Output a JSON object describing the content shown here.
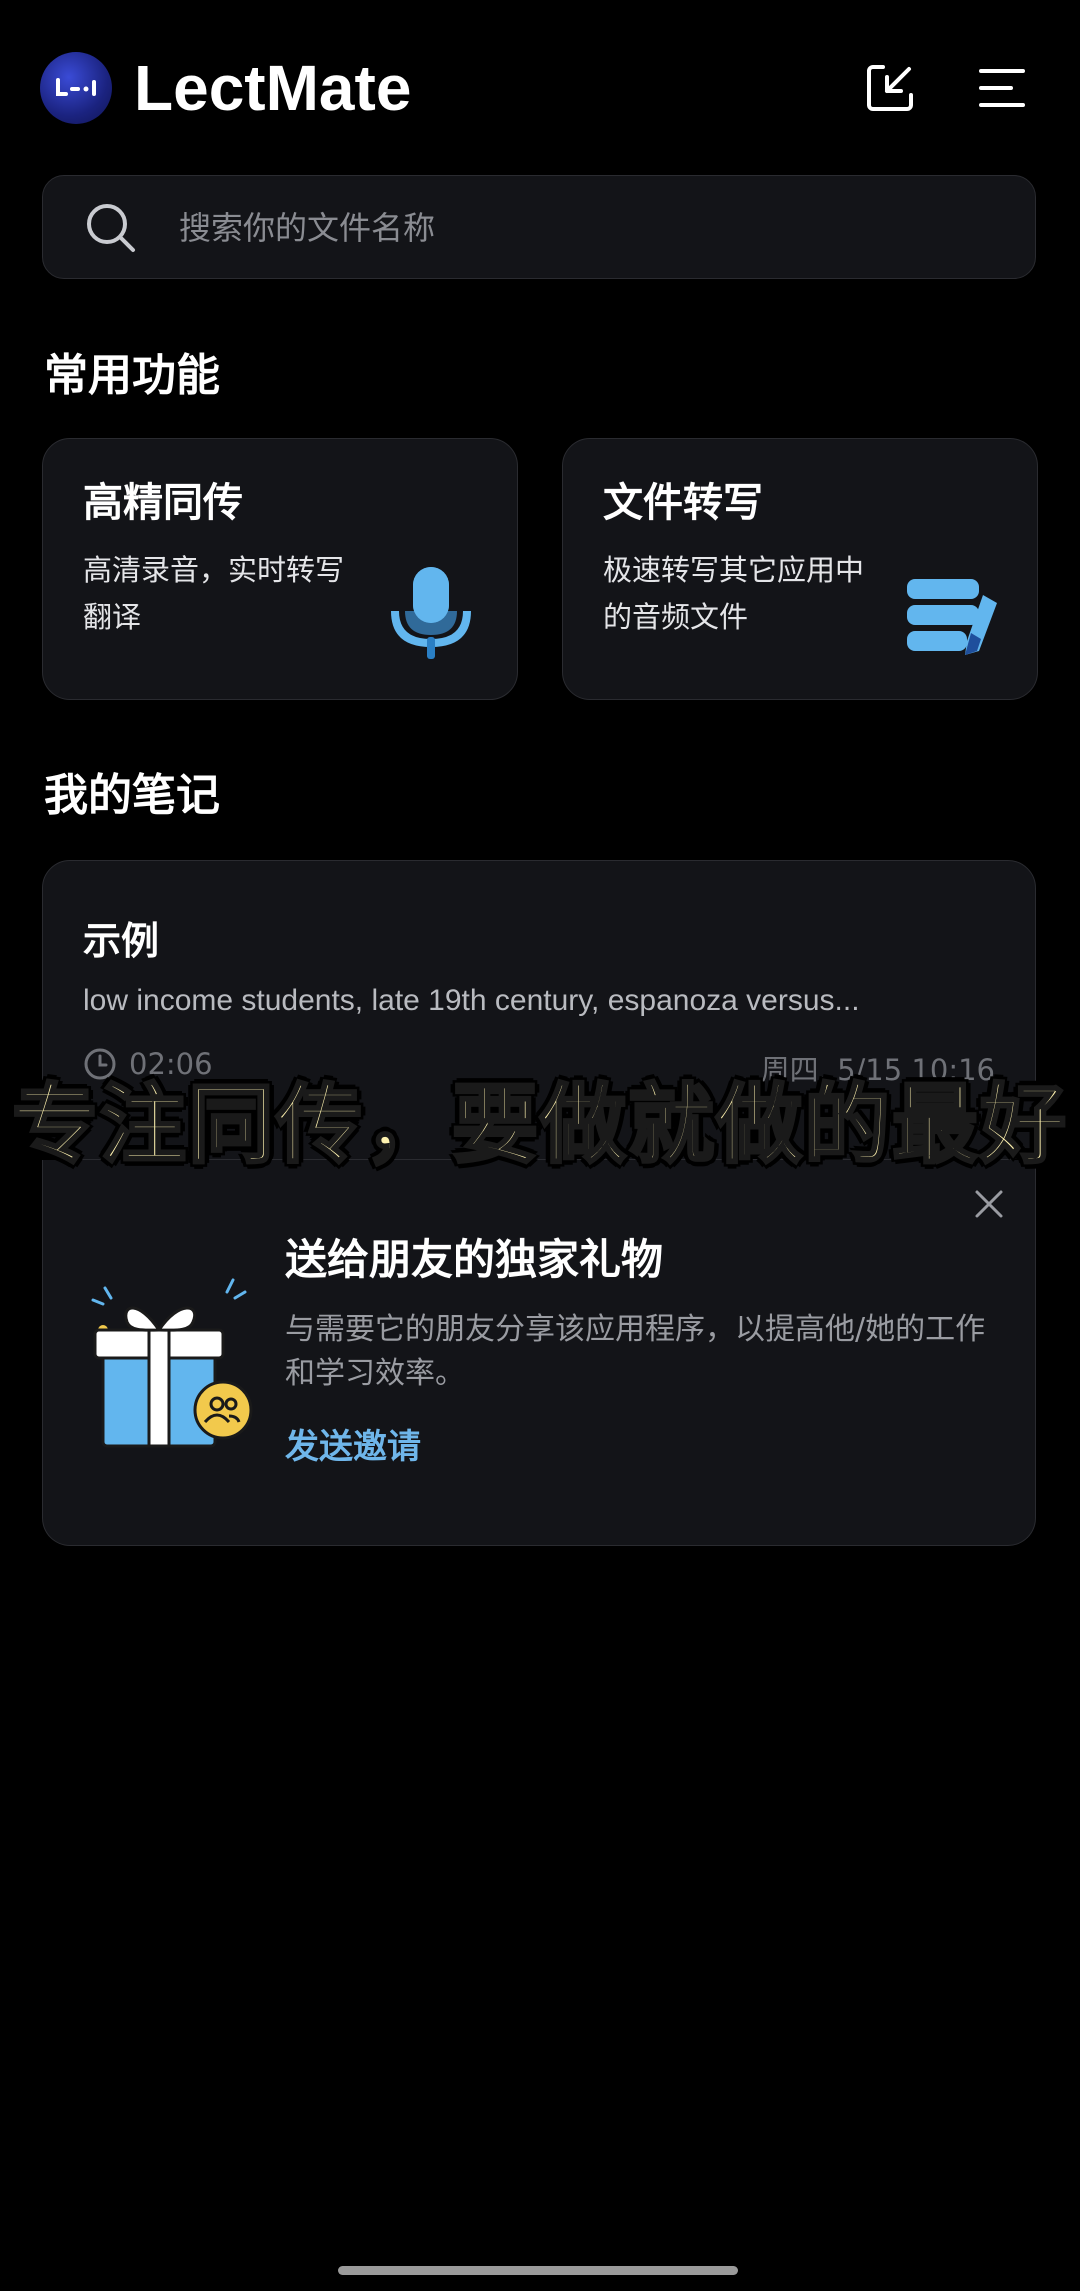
{
  "header": {
    "app_name": "LectMate",
    "logo_text": "L-·I"
  },
  "search": {
    "placeholder": "搜索你的文件名称",
    "value": ""
  },
  "sections": {
    "common_features": "常用功能",
    "my_notes": "我的笔记"
  },
  "features": [
    {
      "title": "高精同传",
      "description": "高清录音，实时转写翻译",
      "icon": "microphone-icon"
    },
    {
      "title": "文件转写",
      "description": "极速转写其它应用中的音频文件",
      "icon": "document-stack-icon"
    }
  ],
  "note": {
    "title": "示例",
    "preview": "low income students, late 19th century, espanoza versus...",
    "duration": "02:06",
    "date": "周四, 5/15 10:16"
  },
  "invite": {
    "title": "送给朋友的独家礼物",
    "description": "与需要它的朋友分享该应用程序，以提高他/她的工作和学习效率。",
    "link_label": "发送邀请"
  },
  "overlay": {
    "caption": "专注同传，要做就做的最好"
  },
  "colors": {
    "background": "#000000",
    "card": "#131418",
    "accent_link": "#6fb6ea",
    "icon_blue": "#62b6ee",
    "caption_fill": "#fff3b0"
  }
}
